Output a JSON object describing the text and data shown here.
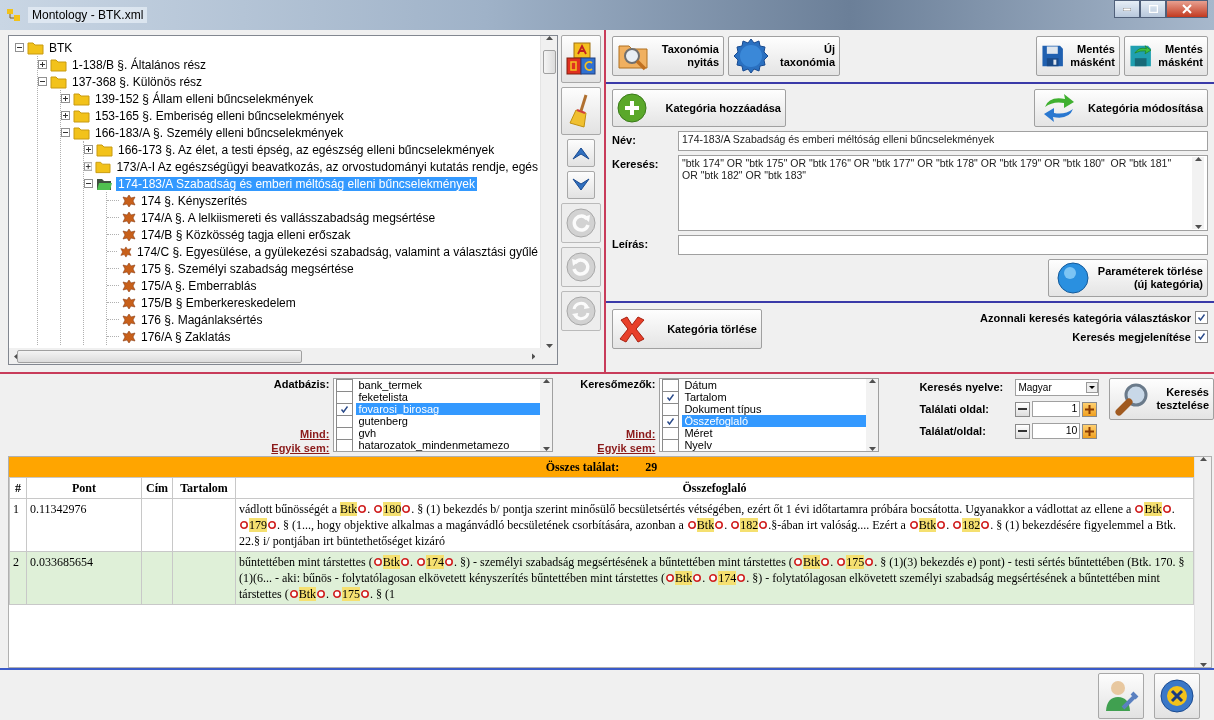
{
  "window": {
    "title": "Montology - BTK.xml"
  },
  "tree": {
    "items": [
      {
        "label": "BTK",
        "kind": "folder",
        "expanded": true,
        "selected": false,
        "children": [
          {
            "label": "1-138/B §. Általános rész",
            "kind": "folder",
            "expanded": false,
            "selected": false
          },
          {
            "label": "137-368 §. Különös rész",
            "kind": "folder",
            "expanded": true,
            "selected": false,
            "children": [
              {
                "label": "139-152 § Állam elleni bűncselekmények",
                "kind": "folder",
                "expanded": false,
                "selected": false
              },
              {
                "label": "153-165 §. Emberiség elleni bűncselekmények",
                "kind": "folder",
                "expanded": false,
                "selected": false
              },
              {
                "label": "166-183/A §. Személy elleni bűncselekmények",
                "kind": "folder",
                "expanded": true,
                "selected": false,
                "children": [
                  {
                    "label": "166-173 §. Az élet, a testi épség, az egészség elleni bűncselekmények",
                    "kind": "folder",
                    "expanded": false,
                    "selected": false
                  },
                  {
                    "label": "173/A-I Az egészségügyi beavatkozás, az orvostudományi kutatás rendje, egés",
                    "kind": "folder",
                    "expanded": false,
                    "selected": false
                  },
                  {
                    "label": "174-183/A Szabadság és emberi méltóság elleni bűncselekmények",
                    "kind": "folder",
                    "expanded": true,
                    "selected": true,
                    "children": [
                      {
                        "label": "174 §. Kényszerítés",
                        "kind": "leaf",
                        "selected": false
                      },
                      {
                        "label": "174/A §. A lelkiismereti és vallásszabadság megsértése",
                        "kind": "leaf",
                        "selected": false
                      },
                      {
                        "label": "174/B § Közkösség tagja elleni erőszak",
                        "kind": "leaf",
                        "selected": false
                      },
                      {
                        "label": "174/C §. Egyesülése, a gyülekezési szabadság, valamint a választási gyűlé",
                        "kind": "leaf",
                        "selected": false
                      },
                      {
                        "label": "175 §. Személyi szabadság megsértése",
                        "kind": "leaf",
                        "selected": false
                      },
                      {
                        "label": "175/A §. Emberrablás",
                        "kind": "leaf",
                        "selected": false
                      },
                      {
                        "label": "175/B § Emberkereskedelem",
                        "kind": "leaf",
                        "selected": false
                      },
                      {
                        "label": "176 §. Magánlaksértés",
                        "kind": "leaf",
                        "selected": false
                      },
                      {
                        "label": "176/A § Zaklatás",
                        "kind": "leaf",
                        "selected": false
                      }
                    ]
                  }
                ]
              }
            ]
          }
        ]
      }
    ]
  },
  "tool_buttons": [
    {
      "kind": "blocks",
      "disabled": false
    },
    {
      "kind": "broom",
      "disabled": false
    },
    {
      "kind": "up",
      "disabled": false
    },
    {
      "kind": "down",
      "disabled": false
    },
    {
      "kind": "redo",
      "disabled": true
    },
    {
      "kind": "undo",
      "disabled": true
    },
    {
      "kind": "sync",
      "disabled": true
    }
  ],
  "toolbar": {
    "left": [
      {
        "kind": "open",
        "lines": [
          "Taxonómia",
          "nyitás"
        ]
      },
      {
        "kind": "new",
        "lines": [
          "Új",
          "taxonómia"
        ]
      }
    ],
    "right": [
      {
        "kind": "save",
        "lines": [
          "Mentés",
          "másként"
        ]
      },
      {
        "kind": "save-as",
        "lines": [
          "Mentés",
          "másként"
        ]
      }
    ]
  },
  "category": {
    "add_button": "Kategória hozzáadása",
    "modify_button": "Kategória módosítása",
    "fields": [
      {
        "label": "Név:",
        "kind": "line",
        "value": "174-183/A Szabadság és emberi méltóság elleni bűncselekmények"
      },
      {
        "label": "Keresés:",
        "kind": "area",
        "value": "\"btk 174\" OR \"btk 175\" OR \"btk 176\" OR \"btk 177\" OR \"btk 178\" OR \"btk 179\" OR \"btk 180\"  OR \"btk 181\" OR \"btk 182\" OR \"btk 183\""
      },
      {
        "label": "Leírás:",
        "kind": "line"
      }
    ],
    "clear_button": [
      "Paraméterek törlése",
      "(új kategória)"
    ],
    "delete_button": "Kategória törlése",
    "options": [
      {
        "label": "Azonnali keresés kategória választáskor",
        "checked": true
      },
      {
        "label": "Keresés megjelenítése",
        "checked": true
      }
    ]
  },
  "search": {
    "lists": [
      {
        "label": "Adatbázis:",
        "all_link": "Mind:",
        "none_link": "Egyik sem:",
        "items": [
          {
            "label": "bank_termek",
            "checked": false,
            "selected": false
          },
          {
            "label": "feketelista",
            "checked": false,
            "selected": false
          },
          {
            "label": "fovarosi_birosag",
            "checked": true,
            "selected": true
          },
          {
            "label": "gutenberg",
            "checked": false,
            "selected": false
          },
          {
            "label": "gvh",
            "checked": false,
            "selected": false
          },
          {
            "label": "hatarozatok_mindenmetamezo",
            "checked": false,
            "selected": false
          }
        ]
      },
      {
        "label": "Keresőmezők:",
        "all_link": "Mind:",
        "none_link": "Egyik sem:",
        "items": [
          {
            "label": "Dátum",
            "checked": false,
            "selected": false
          },
          {
            "label": "Tartalom",
            "checked": true,
            "selected": false
          },
          {
            "label": "Dokument típus",
            "checked": false,
            "selected": false
          },
          {
            "label": "Összefoglaló",
            "checked": true,
            "selected": true
          },
          {
            "label": "Méret",
            "checked": false,
            "selected": false
          },
          {
            "label": "Nyelv",
            "checked": false,
            "selected": false
          }
        ]
      }
    ],
    "language": {
      "label": "Keresés nyelve:",
      "value": "Magyar"
    },
    "spinners": [
      {
        "label": "Találati oldal:",
        "value": "1"
      },
      {
        "label": "Találat/oldal:",
        "value": "10"
      }
    ],
    "test_button": [
      "Keresés",
      "tesztelése"
    ]
  },
  "results": {
    "total_label": "Összes találat:",
    "total": "29",
    "columns": [
      "#",
      "Pont",
      "Cím",
      "Tartalom",
      "Összefoglaló"
    ],
    "rows": [
      {
        "number": "1",
        "score": "0.11342976",
        "selected": false,
        "summary": [
          {
            "kind": "plain",
            "text": "vádlott bűnösségét a "
          },
          {
            "kind": "hit",
            "text": "Btk",
            "mark_before": false
          },
          {
            "kind": "plain",
            "text": ". "
          },
          {
            "kind": "hit",
            "text": "180",
            "mark_before": true
          },
          {
            "kind": "plain",
            "text": ". § (1) bekezdés b/ pontja szerint minősülő becsületsértés vétségében, ezért őt 1 évi időtartamra próbára bocsátotta. Ugyanakkor a vádlottat az ellene a "
          },
          {
            "kind": "hit",
            "text": "Btk",
            "mark_before": true
          },
          {
            "kind": "plain",
            "text": ". "
          },
          {
            "kind": "hit",
            "text": "179",
            "mark_before": true
          },
          {
            "kind": "plain",
            "text": ". § (1..., hogy objektive alkalmas a magánvádló becsületének csorbítására, azonban a "
          },
          {
            "kind": "hit",
            "text": "Btk",
            "mark_before": true
          },
          {
            "kind": "plain",
            "text": ". "
          },
          {
            "kind": "hit",
            "text": "182",
            "mark_before": true
          },
          {
            "kind": "plain",
            "text": ".§-ában irt valóság.... Ezért a "
          },
          {
            "kind": "hit",
            "text": "Btk",
            "mark_before": true
          },
          {
            "kind": "plain",
            "text": ". "
          },
          {
            "kind": "hit",
            "text": "182",
            "mark_before": true
          },
          {
            "kind": "plain",
            "text": ". § (1) bekezdésére figyelemmel a Btk. 22.§ i/ pontjában irt büntethetőséget kizáró"
          }
        ]
      },
      {
        "number": "2",
        "score": "0.033685654",
        "selected": true,
        "summary": [
          {
            "kind": "plain",
            "text": "bűntettében mint társtettes ("
          },
          {
            "kind": "hit",
            "text": "Btk",
            "mark_before": true
          },
          {
            "kind": "plain",
            "text": ". "
          },
          {
            "kind": "hit",
            "text": "174",
            "mark_before": true
          },
          {
            "kind": "plain",
            "text": ". §) - személyi szabadság megsértésének a bűntettében mint társtettes ("
          },
          {
            "kind": "hit",
            "text": "Btk",
            "mark_before": true
          },
          {
            "kind": "plain",
            "text": ". "
          },
          {
            "kind": "hit",
            "text": "175",
            "mark_before": true
          },
          {
            "kind": "plain",
            "text": ". § (1)(3) bekezdés e) pont) - testi sértés bűntettében (Btk. 170. § (1)(6... - aki: bűnös - folytatólagosan elkövetett kényszerítés bűntettében mint társtettes ("
          },
          {
            "kind": "hit",
            "text": "Btk",
            "mark_before": true
          },
          {
            "kind": "plain",
            "text": ". "
          },
          {
            "kind": "hit",
            "text": "174",
            "mark_before": true
          },
          {
            "kind": "plain",
            "text": ". §) - folytatólagosan elkövetett személyi szabadság megsértésének a bűntettében mint társtettes ("
          },
          {
            "kind": "hit",
            "text": "Btk",
            "mark_before": true
          },
          {
            "kind": "plain",
            "text": ". "
          },
          {
            "kind": "hit",
            "text": "175",
            "mark_before": true
          },
          {
            "kind": "plain",
            "text": ". § (1"
          }
        ]
      }
    ]
  }
}
